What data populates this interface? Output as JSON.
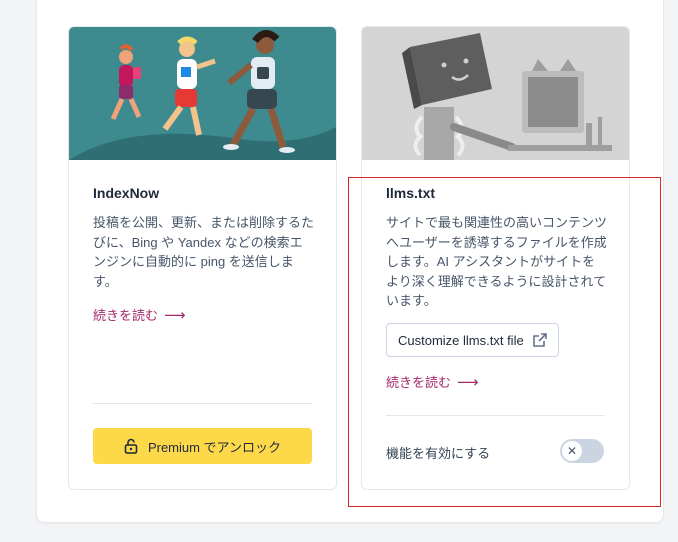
{
  "cards": [
    {
      "title": "IndexNow",
      "description": "投稿を公開、更新、または削除するたびに、Bing や Yandex などの検索エンジンに自動的に ping を送信します。",
      "read_more": "続きを読む",
      "premium_label": "Premium でアンロック",
      "image_bg": "#3d8a8f"
    },
    {
      "title": "llms.txt",
      "description": "サイトで最も関連性の高いコンテンツへユーザーを誘導するファイルを作成します。AI アシスタントがサイトをより深く理解できるように設計されています。",
      "customize_label": "Customize llms.txt file",
      "read_more": "続きを読む",
      "toggle_label": "機能を有効にする",
      "toggle_enabled": false,
      "image_bg": "#d4d4d4"
    }
  ],
  "colors": {
    "accent_link": "#a4286a",
    "premium_button": "#fdd94a",
    "highlight_border": "#dc2626"
  },
  "icons": [
    "lock-icon",
    "external-link-icon",
    "arrow-right-icon",
    "close-icon"
  ]
}
